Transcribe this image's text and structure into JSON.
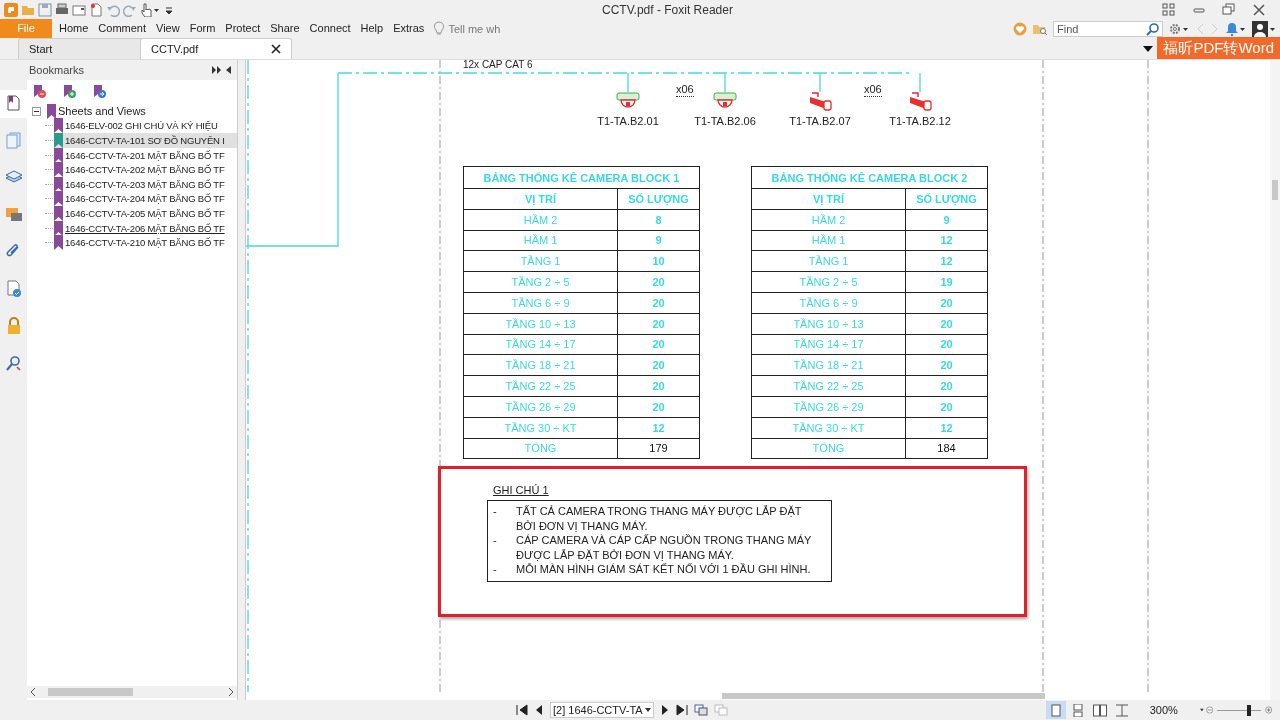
{
  "window": {
    "title": "CCTV.pdf - Foxit Reader"
  },
  "menu": [
    {
      "label": "File",
      "kind": "file"
    },
    {
      "label": "Home",
      "kind": "menu"
    },
    {
      "label": "Comment",
      "kind": "menu"
    },
    {
      "label": "View",
      "kind": "menu"
    },
    {
      "label": "Form",
      "kind": "menu"
    },
    {
      "label": "Protect",
      "kind": "menu"
    },
    {
      "label": "Share",
      "kind": "menu"
    },
    {
      "label": "Connect",
      "kind": "menu"
    },
    {
      "label": "Help",
      "kind": "menu"
    },
    {
      "label": "Extras",
      "kind": "menu"
    }
  ],
  "tell_me": {
    "placeholder": "Tell me wh"
  },
  "find": {
    "placeholder": "Find"
  },
  "promo_button": "福昕PDF转Word",
  "tabs": [
    {
      "label": "Start",
      "selected": false,
      "closable": false
    },
    {
      "label": "CCTV.pdf",
      "selected": true,
      "closable": true
    }
  ],
  "side_tools": [
    {
      "kind": "page",
      "selected": true
    },
    {
      "kind": "pages",
      "selected": false
    },
    {
      "kind": "layers",
      "selected": false
    },
    {
      "kind": "comments",
      "selected": false
    },
    {
      "kind": "attachment",
      "selected": false
    },
    {
      "kind": "signature",
      "selected": false
    },
    {
      "kind": "security",
      "selected": false
    },
    {
      "kind": "search",
      "selected": false
    }
  ],
  "bookmarks": {
    "title": "Bookmarks",
    "tree": [
      {
        "label": "Sheets and Views",
        "expanded": true,
        "selected": false,
        "underlined": false,
        "children": [
          {
            "label": "1646-ELV-002 GHI CHÚ VÀ KÝ HIỆU",
            "selected": false,
            "underlined": false
          },
          {
            "label": "1646-CCTV-TA-101 SƠ ĐỒ NGUYÊN I",
            "selected": true,
            "underlined": false
          },
          {
            "label": "1646-CCTV-TA-201 MẶT BẰNG BỐ TF",
            "selected": false,
            "underlined": false
          },
          {
            "label": "1646-CCTV-TA-202 MẶT BẰNG BỐ TF",
            "selected": false,
            "underlined": false
          },
          {
            "label": "1646-CCTV-TA-203 MẶT BẰNG BỐ TF",
            "selected": false,
            "underlined": false
          },
          {
            "label": "1646-CCTV-TA-204 MẶT BẰNG BỐ TF",
            "selected": false,
            "underlined": false
          },
          {
            "label": "1646-CCTV-TA-205 MẶT BẰNG BỐ TF",
            "selected": false,
            "underlined": false
          },
          {
            "label": "1646-CCTV-TA-206 MẶT BẰNG BỐ TF",
            "selected": false,
            "underlined": true
          },
          {
            "label": "1646-CCTV-TA-210 MẶT BẰNG BỐ TF",
            "selected": false,
            "underlined": false
          }
        ]
      }
    ]
  },
  "drawing": {
    "cable_label": "12x CÁP CAT 6",
    "cameras": [
      {
        "kind": "dome",
        "label": "T1-TA.B2.01"
      },
      {
        "kind": "dome",
        "label": "T1-TA.B2.06"
      },
      {
        "kind": "bullet",
        "label": "T1-TA.B2.07"
      },
      {
        "kind": "bullet",
        "label": "T1-TA.B2.12"
      }
    ],
    "multipliers": [
      "x06",
      "x06"
    ]
  },
  "tables": [
    {
      "title": "BẢNG THỐNG KÊ CAMERA BLOCK 1",
      "columns": [
        "VỊ TRÍ",
        "SỐ LƯỢNG"
      ],
      "rows": [
        [
          "HẦM 2",
          "8"
        ],
        [
          "HẦM 1",
          "9"
        ],
        [
          "TẦNG 1",
          "10"
        ],
        [
          "TẦNG 2 ÷ 5",
          "20"
        ],
        [
          "TẦNG 6 ÷ 9",
          "20"
        ],
        [
          "TẦNG 10 ÷ 13",
          "20"
        ],
        [
          "TẦNG 14 ÷ 17",
          "20"
        ],
        [
          "TẦNG 18 ÷ 21",
          "20"
        ],
        [
          "TẦNG 22 ÷ 25",
          "20"
        ],
        [
          "TẦNG 26 ÷ 29",
          "20"
        ],
        [
          "TẦNG 30 ÷ KT",
          "12"
        ]
      ],
      "total": [
        "TỔNG",
        "179"
      ]
    },
    {
      "title": "BẢNG THỐNG KÊ CAMERA BLOCK 2",
      "columns": [
        "VỊ TRÍ",
        "SỐ LƯỢNG"
      ],
      "rows": [
        [
          "HẦM 2",
          "9"
        ],
        [
          "HẦM 1",
          "12"
        ],
        [
          "TẦNG 1",
          "12"
        ],
        [
          "TẦNG 2 ÷ 5",
          "19"
        ],
        [
          "TẦNG 6 ÷ 9",
          "20"
        ],
        [
          "TẦNG 10 ÷ 13",
          "20"
        ],
        [
          "TẦNG 14 ÷ 17",
          "20"
        ],
        [
          "TẦNG 18 ÷ 21",
          "20"
        ],
        [
          "TẦNG 22 ÷ 25",
          "20"
        ],
        [
          "TẦNG 26 ÷ 29",
          "20"
        ],
        [
          "TẦNG 30 ÷ KT",
          "12"
        ]
      ],
      "total": [
        "TỔNG",
        "184"
      ]
    }
  ],
  "note": {
    "title": "GHI CHÚ 1",
    "highlighted": true,
    "items": [
      {
        "bullet": "-",
        "text": "TẤT CẢ CAMERA TRONG THANG MÁY ĐƯỢC LẮP ĐẶT BỞI ĐƠN VỊ THANG MÁY."
      },
      {
        "bullet": "-",
        "text": "CÁP CAMERA VÀ CÁP CẤP NGUỒN TRONG THANG MÁY ĐƯỢC LẮP ĐẶT BỞI ĐƠN VỊ THANG MÁY."
      },
      {
        "bullet": "-",
        "text": "MỖI MÀN HÌNH GIÁM SÁT KẾT NỐI VỚI 1 ĐẦU GHI HÌNH."
      }
    ]
  },
  "status": {
    "page": "[2] 1646-CCTV-TA",
    "view_modes": [
      {
        "kind": "single",
        "selected": true
      },
      {
        "kind": "continuous",
        "selected": false
      },
      {
        "kind": "facing",
        "selected": false
      },
      {
        "kind": "cover",
        "selected": false
      }
    ],
    "zoom": "300%",
    "zoom_slider": {
      "level": 0.73
    }
  }
}
